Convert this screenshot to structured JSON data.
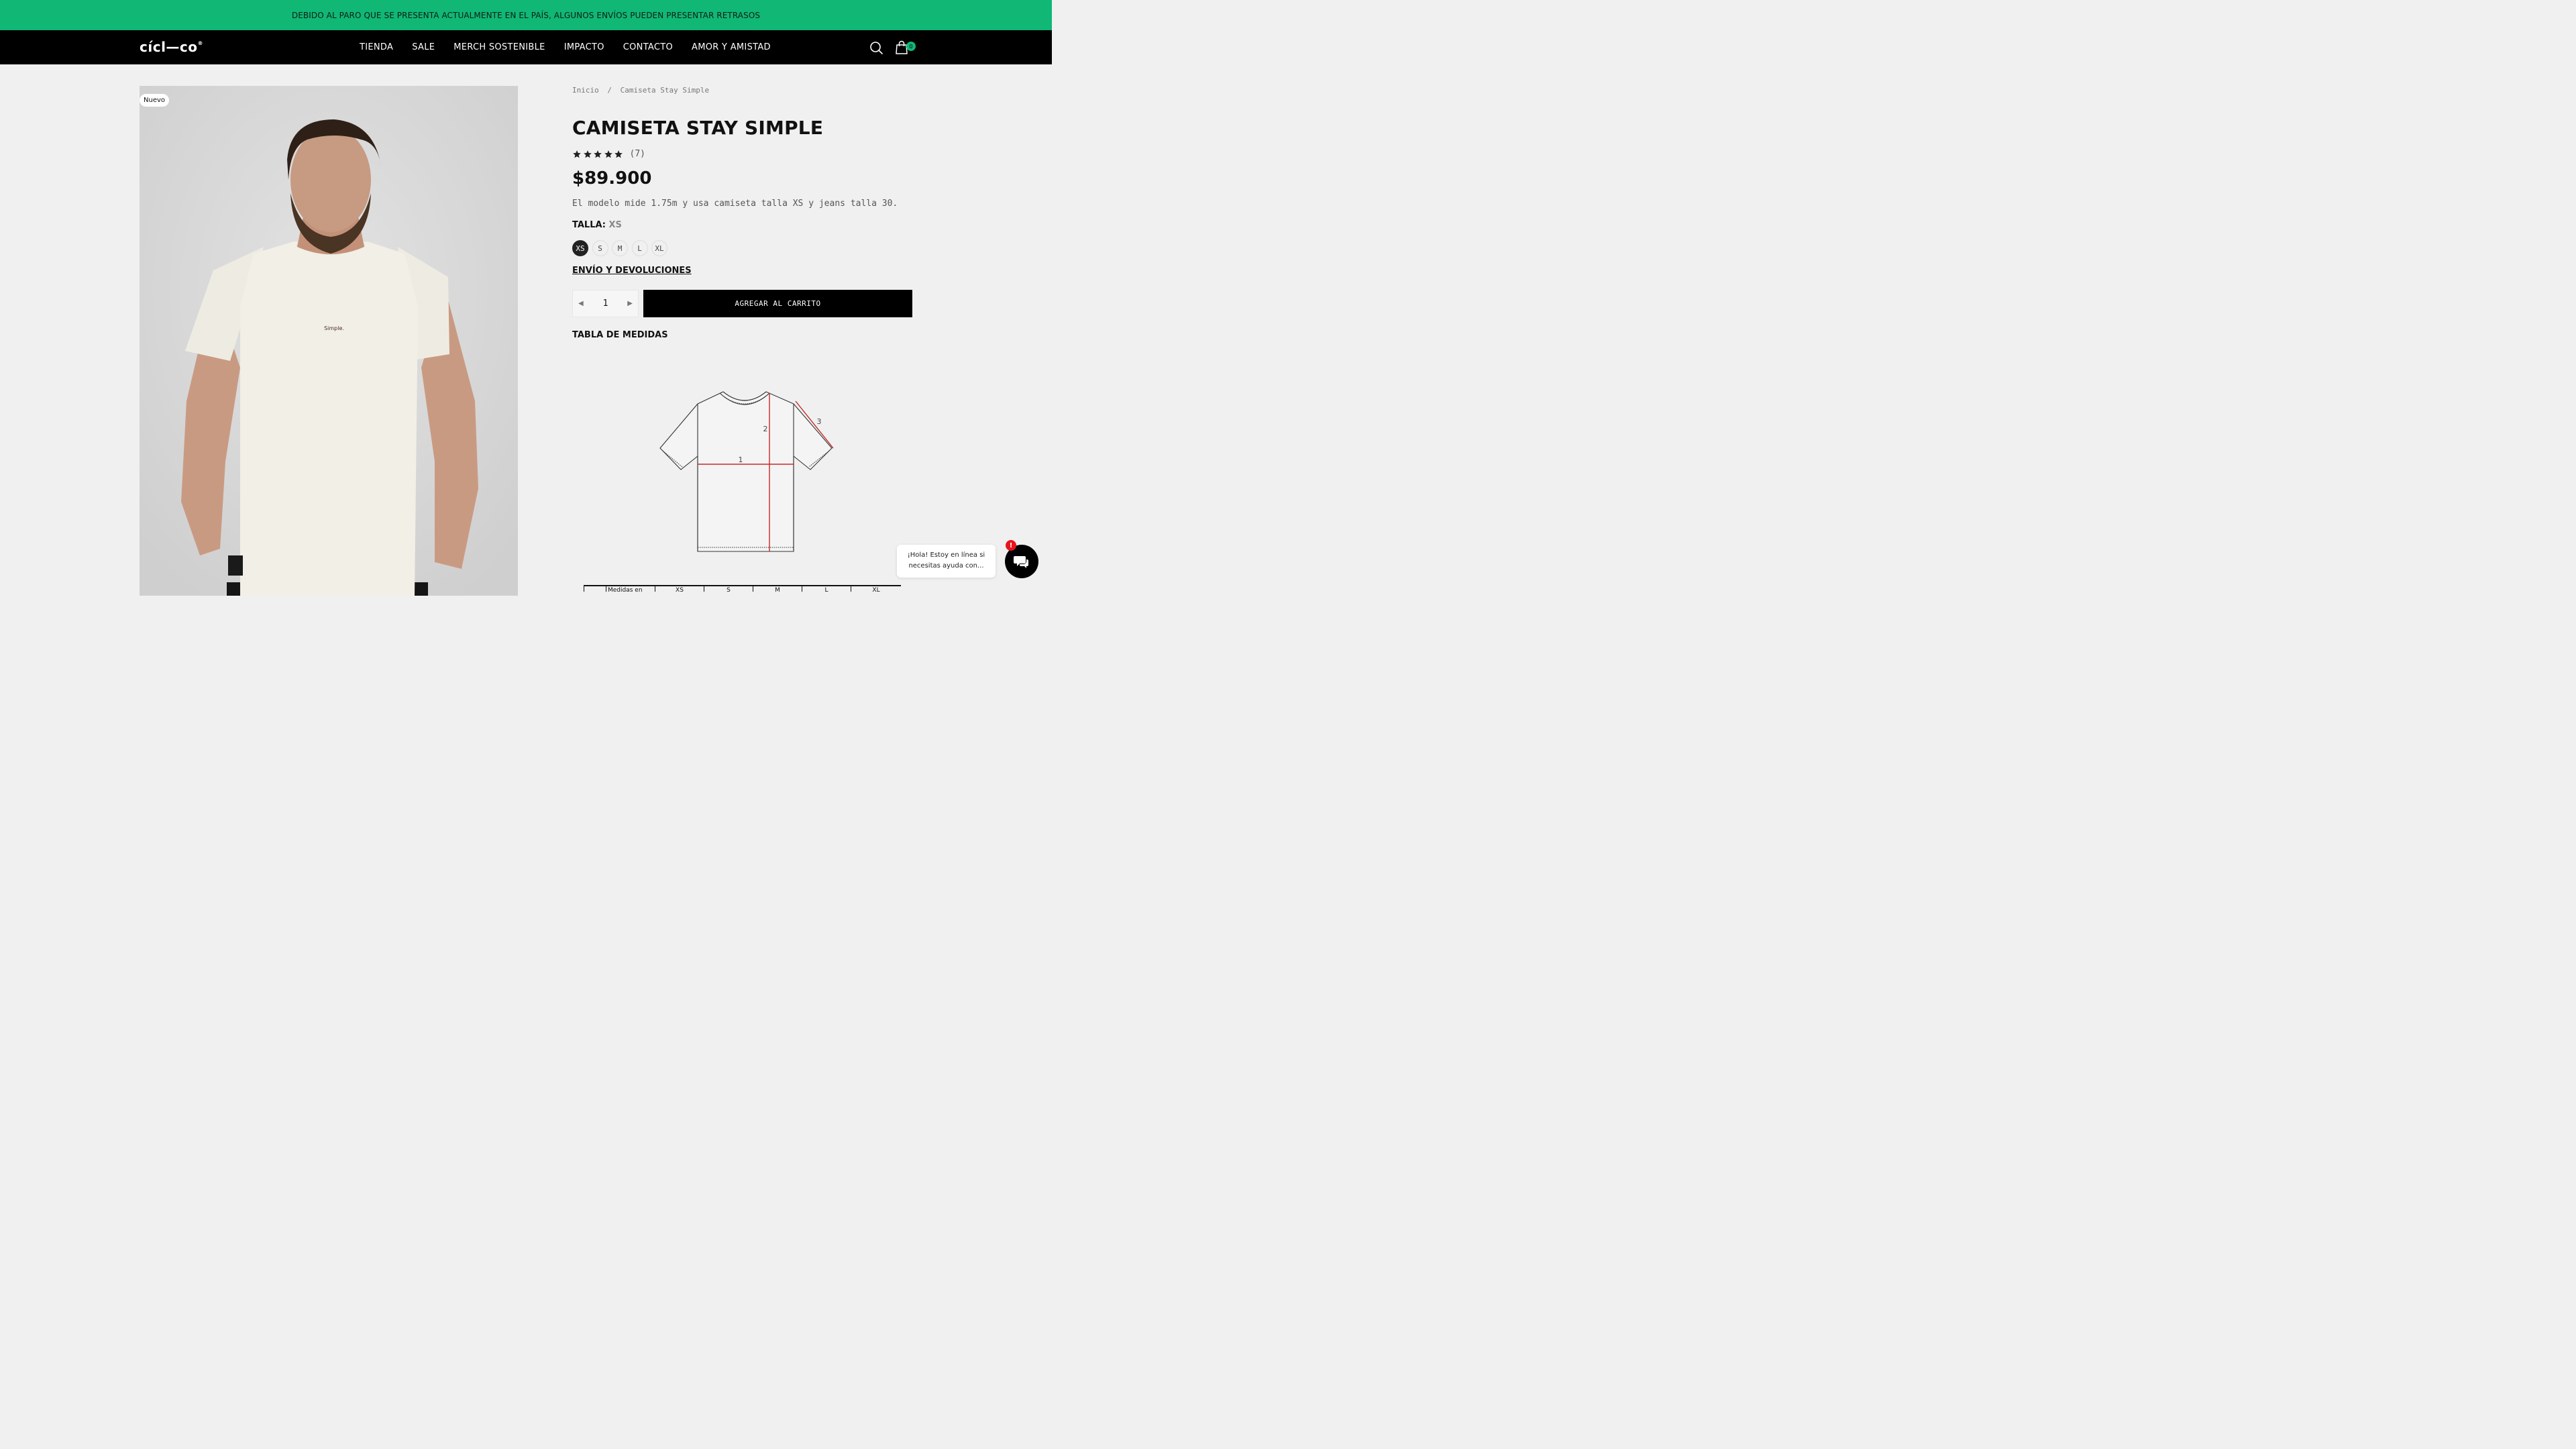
{
  "announcement": {
    "text": "DEBIDO AL PARO QUE SE PRESENTA ACTUALMENTE EN EL PAÍS, ALGUNOS ENVÍOS PUEDEN PRESENTAR RETRASOS"
  },
  "header": {
    "logo": "cícl—co",
    "logo_mark": "®",
    "nav": [
      "TIENDA",
      "SALE",
      "MERCH SOSTENIBLE",
      "IMPACTO",
      "CONTACTO",
      "AMOR Y AMISTAD"
    ],
    "icons": [
      "search-icon",
      "cart-icon"
    ],
    "cart_count": "0"
  },
  "product": {
    "badge": "Nuevo",
    "image_icon": "product-photo",
    "shirt_print": "Simple.",
    "breadcrumb": [
      "Inicio",
      "/",
      "Camiseta Stay Simple"
    ],
    "title": "CAMISETA STAY SIMPLE",
    "rating": 5,
    "rating_count": "(7)",
    "price": "$89.900",
    "model_note": "El modelo mide 1.75m y usa camiseta talla XS y jeans talla 30.",
    "size_label": "TALLA:",
    "size_selected": "XS",
    "sizes": [
      "XS",
      "S",
      "M",
      "L",
      "XL"
    ],
    "shipping_link": "ENVÍO Y DEVOLUCIONES",
    "quantity": "1",
    "add_to_cart": "AGREGAR AL CARRITO",
    "size_chart_title": "TABLA DE MEDIDAS",
    "diagram_labels": [
      "1",
      "2",
      "3"
    ],
    "table_header": [
      "",
      "Medidas en",
      "XS",
      "S",
      "M",
      "L",
      "XL"
    ]
  },
  "chat": {
    "message": "¡Hola! Estoy en línea si necesitas ayuda con...",
    "alert": "!",
    "icon": "chat-icon"
  },
  "colors": {
    "accent": "#10b775",
    "dark": "#000000",
    "alert": "#e8141b",
    "measure_line": "#c62828"
  }
}
